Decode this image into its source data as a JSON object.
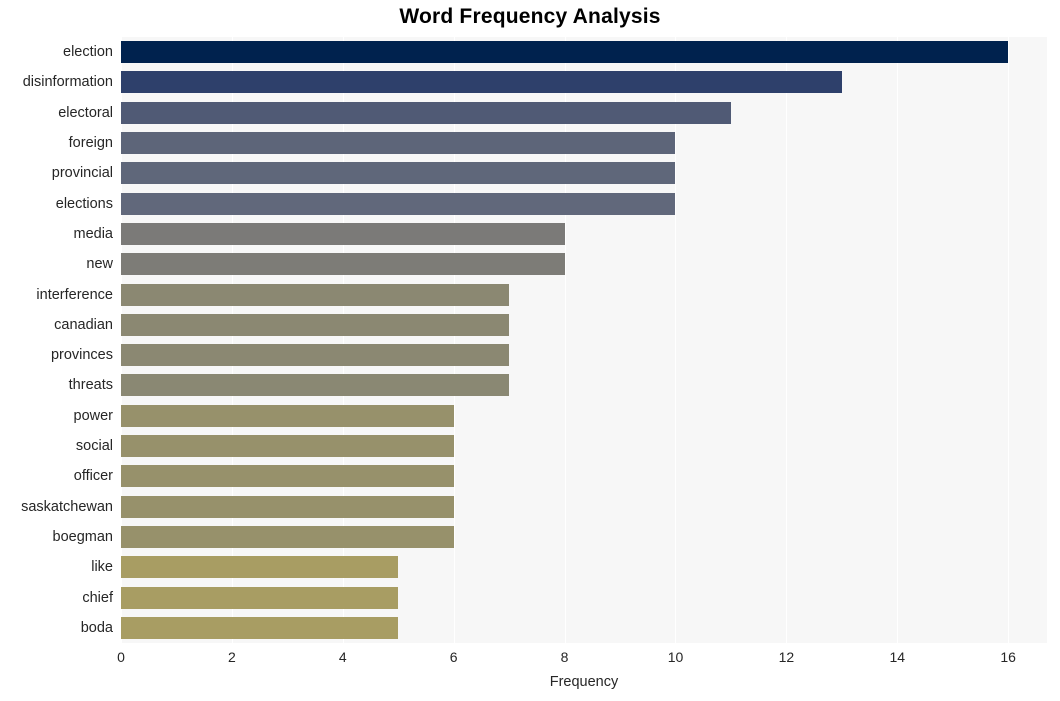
{
  "chart_data": {
    "type": "bar",
    "orientation": "horizontal",
    "title": "Word Frequency Analysis",
    "xlabel": "Frequency",
    "ylabel": "",
    "xlim": [
      0,
      16.7
    ],
    "xticks": [
      0,
      2,
      4,
      6,
      8,
      10,
      12,
      14,
      16
    ],
    "grid": "vertical",
    "legend": "none",
    "background": "#f7f7f7",
    "gridline_color": "#ffffff",
    "categories": [
      "election",
      "disinformation",
      "electoral",
      "foreign",
      "provincial",
      "elections",
      "media",
      "new",
      "interference",
      "canadian",
      "provinces",
      "threats",
      "power",
      "social",
      "officer",
      "saskatchewan",
      "boegman",
      "like",
      "chief",
      "boda"
    ],
    "values": [
      16,
      13,
      11,
      10,
      10,
      10,
      8,
      8,
      7,
      7,
      7,
      7,
      6,
      6,
      6,
      6,
      6,
      5,
      5,
      5
    ],
    "colors": [
      "#00224e",
      "#2e406b",
      "#505a75",
      "#5d6579",
      "#5f677a",
      "#61687b",
      "#7b7a78",
      "#7d7c77",
      "#8b8872",
      "#8b8872",
      "#8b8872",
      "#8a8873",
      "#97916b",
      "#97916b",
      "#97916b",
      "#97916b",
      "#97916b",
      "#a89d63",
      "#a89d63",
      "#a89d63"
    ]
  },
  "title_text": "Word Frequency Analysis",
  "axis": {
    "x_label": "Frequency",
    "tick_0": "0",
    "tick_1": "2",
    "tick_2": "4",
    "tick_3": "6",
    "tick_4": "8",
    "tick_5": "10",
    "tick_6": "12",
    "tick_7": "14",
    "tick_8": "16"
  }
}
